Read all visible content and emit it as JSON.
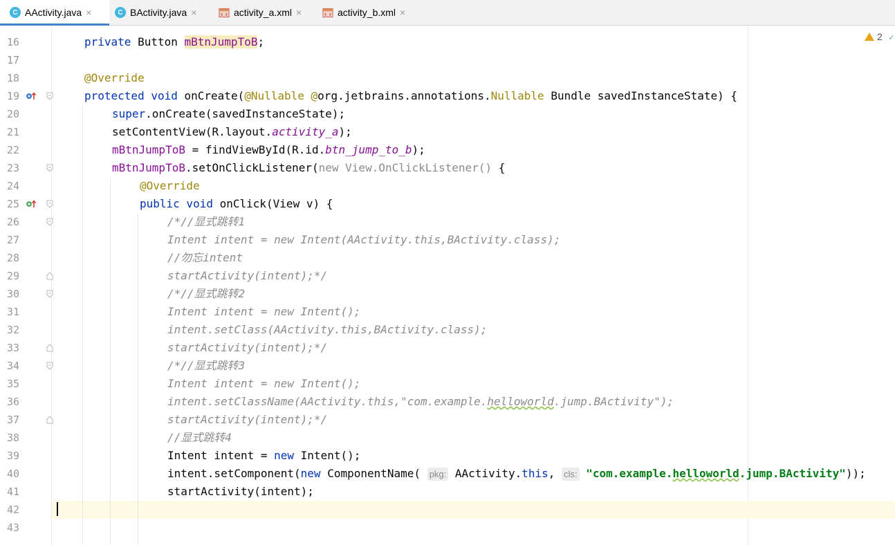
{
  "tabs": [
    {
      "label": "AActivity.java",
      "icon": "java-class-icon",
      "active": true
    },
    {
      "label": "BActivity.java",
      "icon": "java-class-icon",
      "active": false
    },
    {
      "label": "activity_a.xml",
      "icon": "xml-layout-icon",
      "active": false
    },
    {
      "label": "activity_b.xml",
      "icon": "xml-layout-icon",
      "active": false
    }
  ],
  "tab_icon_letter": "C",
  "close_glyph": "×",
  "inspections": {
    "warnings": "2"
  },
  "line_numbers": [
    "16",
    "17",
    "18",
    "19",
    "20",
    "21",
    "22",
    "23",
    "24",
    "25",
    "26",
    "27",
    "28",
    "29",
    "30",
    "31",
    "32",
    "33",
    "34",
    "35",
    "36",
    "37",
    "38",
    "39",
    "40",
    "41",
    "42",
    "43"
  ],
  "code": {
    "l16": {
      "kw": "private",
      "type": " Button ",
      "field": "mBtnJumpToB",
      "end": ";"
    },
    "l18": {
      "annot": "@Override"
    },
    "l19": {
      "kw1": "protected",
      "kw2": " void",
      "name": " onCreate(",
      "annot1": "@Nullable",
      "annot2": " @",
      "pkg": "org.jetbrains.annotations.",
      "annot3": "Nullable",
      "rest": " Bundle savedInstanceState) {"
    },
    "l20": {
      "kw": "super",
      "rest": ".onCreate(savedInstanceState);"
    },
    "l21": {
      "pre": "setContentView(R.layout.",
      "field": "activity_a",
      "end": ");"
    },
    "l22": {
      "field": "mBtnJumpToB",
      "mid": " = findViewById(R.id.",
      "field2": "btn_jump_to_b",
      "end": ");"
    },
    "l23": {
      "field": "mBtnJumpToB",
      "mid": ".setOnClickListener(",
      "kw": "new",
      "gray": " View.OnClickListener()",
      "end": " {"
    },
    "l24": {
      "annot": "@Override"
    },
    "l25": {
      "kw1": "public",
      "kw2": " void",
      "rest": " onClick(View v) {"
    },
    "l26": {
      "comment": "/*//显式跳转1"
    },
    "l27": {
      "comment": "Intent intent = new Intent(AActivity.this,BActivity.class);"
    },
    "l28": {
      "comment": "//勿忘intent"
    },
    "l29": {
      "comment": "startActivity(intent);*/"
    },
    "l30": {
      "comment": "/*//显式跳转2"
    },
    "l31": {
      "comment": "Intent intent = new Intent();"
    },
    "l32": {
      "comment": "intent.setClass(AActivity.this,BActivity.class);"
    },
    "l33": {
      "comment": "startActivity(intent);*/"
    },
    "l34": {
      "comment": "/*//显式跳转3"
    },
    "l35": {
      "comment": "Intent intent = new Intent();"
    },
    "l36": {
      "c1": "intent.setClassName(AActivity.this,\"com.example.",
      "c2": "helloworld",
      "c3": ".jump.BActivity\");"
    },
    "l37": {
      "comment": "startActivity(intent);*/"
    },
    "l38": {
      "comment": "//显式跳转4"
    },
    "l39": {
      "pre": "Intent intent = ",
      "kw": "new",
      "end": " Intent();"
    },
    "l40": {
      "pre": "intent.setComponent(",
      "kw": "new",
      "mid": " ComponentName(",
      "hint1": "pkg:",
      "mid2": " AActivity.",
      "kw2": "this",
      "comma": ",",
      "hint2": "cls:",
      "s1": "\"com.example.",
      "s2": "helloworld",
      "s3": ".jump.BActivity\"",
      "end": "));"
    },
    "l41": {
      "rest": "startActivity(intent);"
    }
  }
}
